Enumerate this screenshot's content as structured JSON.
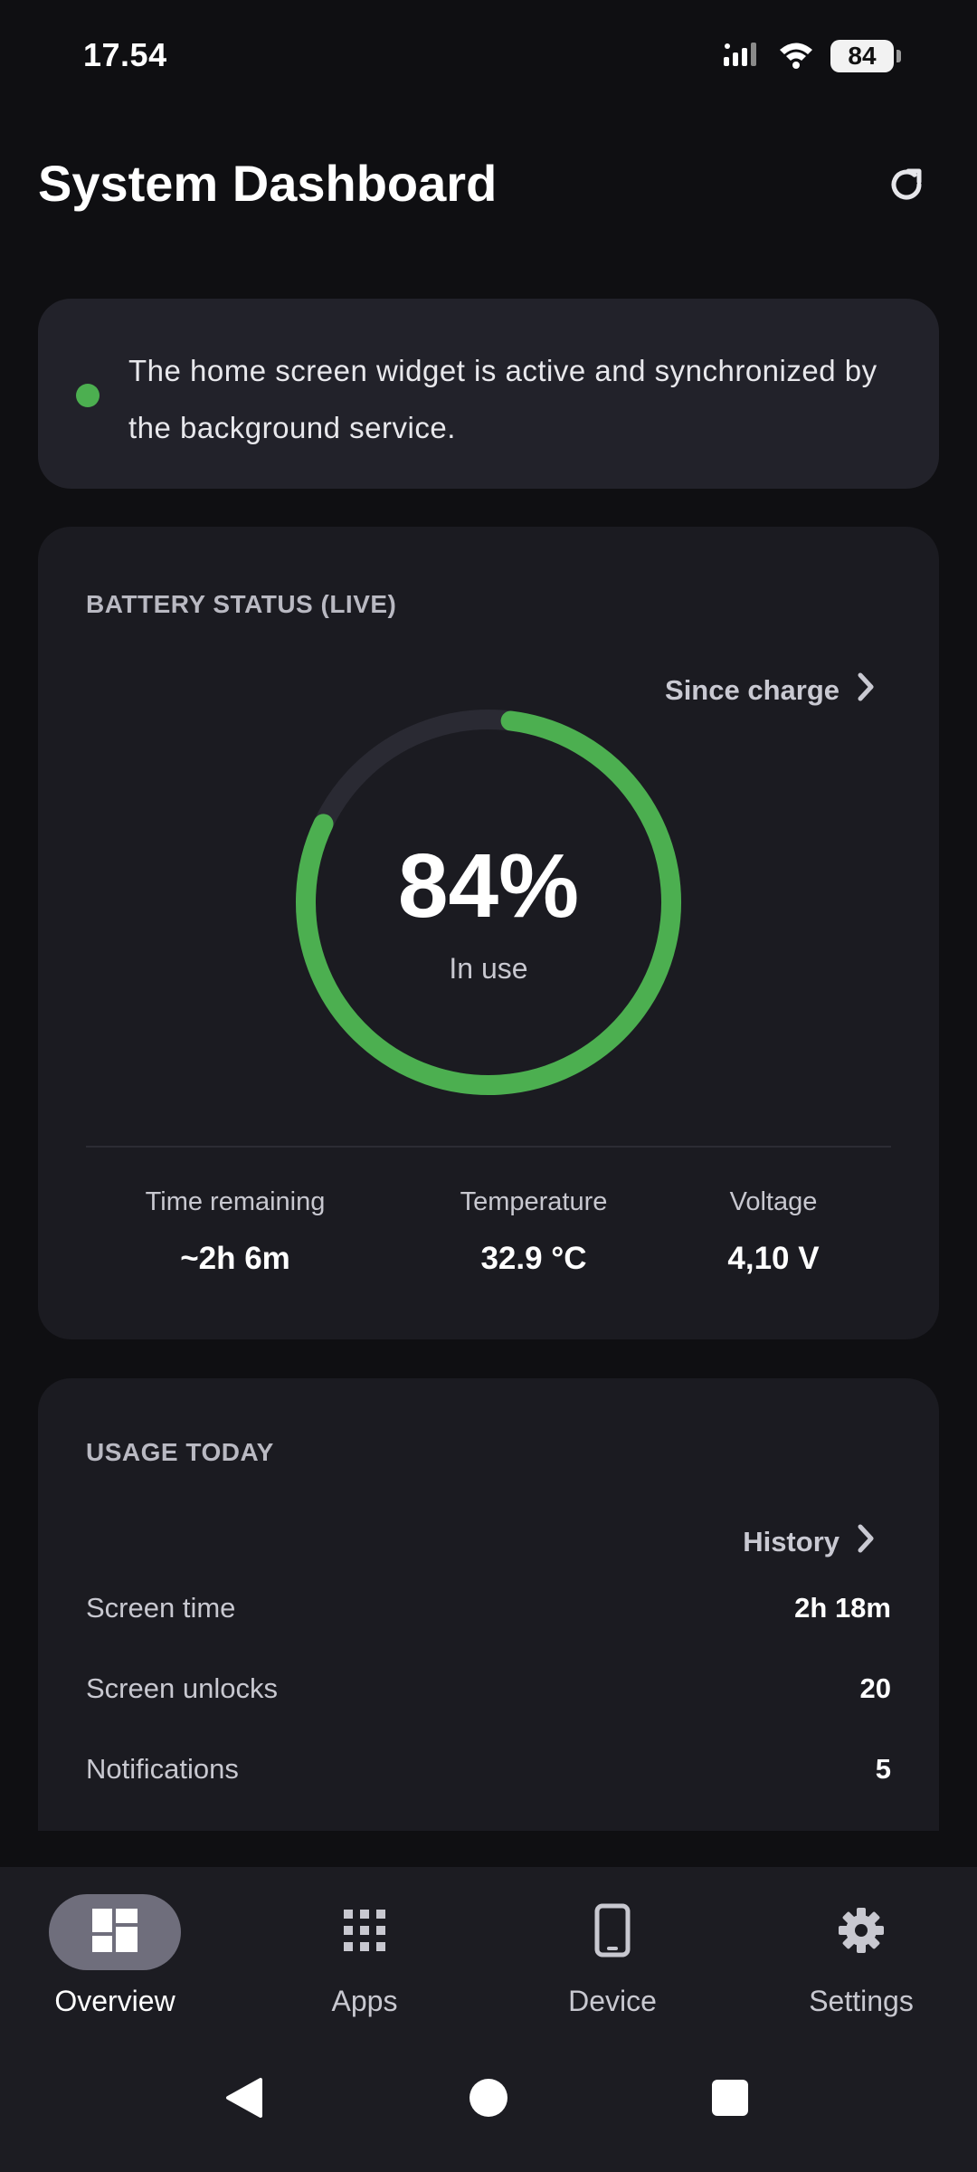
{
  "status_bar": {
    "time": "17.54",
    "battery_level": "84",
    "icons": [
      "signal-icon",
      "wifi-icon",
      "battery-icon"
    ]
  },
  "header": {
    "title": "System Dashboard",
    "refresh_icon": "refresh-icon"
  },
  "widget_info": {
    "text": "The home screen widget is active and synchronized by the background service.",
    "status_color": "#4caf50"
  },
  "battery": {
    "section_title": "BATTERY STATUS (LIVE)",
    "link_label": "Since charge",
    "percent_text": "84%",
    "percent_value": 84,
    "state": "In use",
    "ring_color": "#4caf50",
    "track_color": "#2a2a33",
    "stats": [
      {
        "label": "Time remaining",
        "value": "~2h 6m"
      },
      {
        "label": "Temperature",
        "value": "32.9 °C"
      },
      {
        "label": "Voltage",
        "value": "4,10 V"
      }
    ]
  },
  "usage": {
    "section_title": "USAGE TODAY",
    "link_label": "History",
    "rows": [
      {
        "label": "Screen time",
        "value": "2h 18m"
      },
      {
        "label": "Screen unlocks",
        "value": "20"
      },
      {
        "label": "Notifications",
        "value": "5"
      }
    ]
  },
  "bottom_nav": {
    "items": [
      {
        "label": "Overview",
        "icon": "dashboard-icon",
        "active": true
      },
      {
        "label": "Apps",
        "icon": "apps-grid-icon",
        "active": false
      },
      {
        "label": "Device",
        "icon": "phone-icon",
        "active": false
      },
      {
        "label": "Settings",
        "icon": "gear-icon",
        "active": false
      }
    ]
  },
  "system_nav": {
    "icons": [
      "back-icon",
      "home-icon",
      "recents-icon"
    ]
  }
}
